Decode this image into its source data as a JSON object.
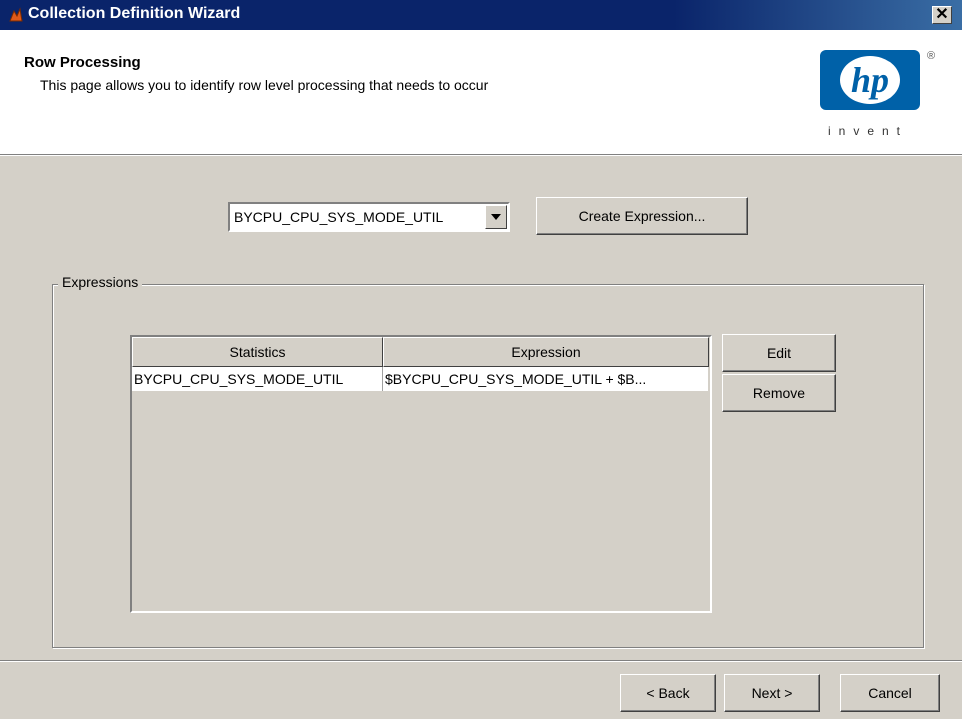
{
  "window": {
    "title": "Collection Definition Wizard",
    "close_glyph": "✕"
  },
  "header": {
    "title": "Row Processing",
    "subtitle": "This page allows you to identify row level processing that needs to occur",
    "logo_text": "invent",
    "logo_mark": "hp",
    "registered": "®"
  },
  "statistic_select": {
    "selected": "BYCPU_CPU_SYS_MODE_UTIL"
  },
  "create_expression_label": "Create Expression...",
  "expressions": {
    "group_label": "Expressions",
    "columns": [
      "Statistics",
      "Expression"
    ],
    "rows": [
      [
        "BYCPU_CPU_SYS_MODE_UTIL",
        "$BYCPU_CPU_SYS_MODE_UTIL + $B..."
      ]
    ],
    "edit_label": "Edit",
    "remove_label": "Remove"
  },
  "footer": {
    "back_label": "< Back",
    "next_label": "Next >",
    "cancel_label": "Cancel"
  },
  "colors": {
    "titlebar": "#0a246a",
    "face": "#d4d0c8",
    "hp_blue": "#0061a8"
  },
  "icons": {
    "app": "wizard-app-icon",
    "close": "close-icon",
    "dropdown": "chevron-down-icon",
    "logo": "hp-logo"
  }
}
